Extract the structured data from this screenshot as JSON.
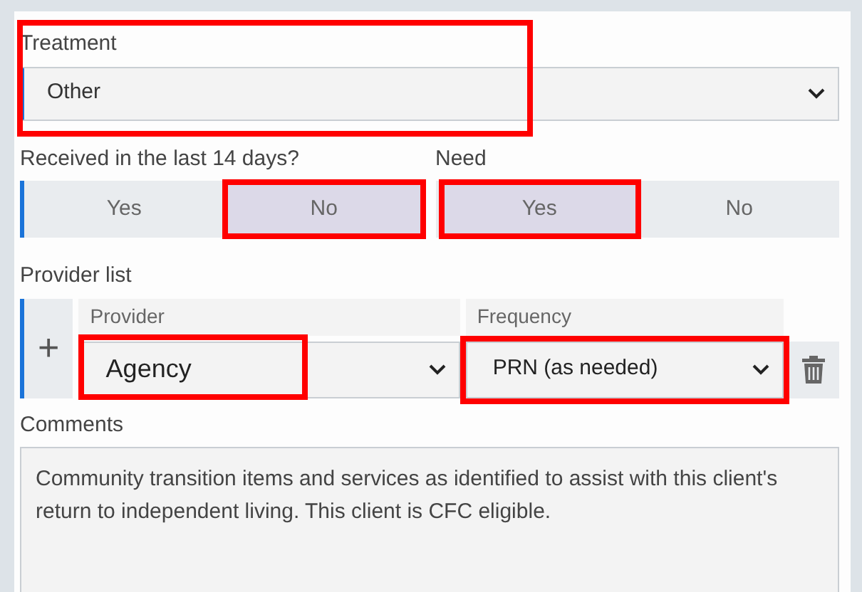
{
  "treatment": {
    "label": "Treatment",
    "value": "Other",
    "highlighted": true
  },
  "toggles": [
    {
      "label": "Received in the last 14 days?",
      "accent": true,
      "options": [
        {
          "label": "Yes",
          "selected": false,
          "highlighted": false
        },
        {
          "label": "No",
          "selected": true,
          "highlighted": true
        }
      ]
    },
    {
      "label": "Need",
      "accent": false,
      "options": [
        {
          "label": "Yes",
          "selected": true,
          "highlighted": true
        },
        {
          "label": "No",
          "selected": false,
          "highlighted": false
        }
      ]
    }
  ],
  "provider_list": {
    "label": "Provider list",
    "add_button": "+",
    "columns": [
      "Provider",
      "Frequency"
    ],
    "rows": [
      {
        "provider": "Agency",
        "provider_highlighted": true,
        "frequency": "PRN (as needed)",
        "frequency_highlighted": true
      }
    ]
  },
  "comments": {
    "label": "Comments",
    "value": "Community transition items and services as identified to assist with this client's return to independent living. This client is CFC eligible."
  }
}
